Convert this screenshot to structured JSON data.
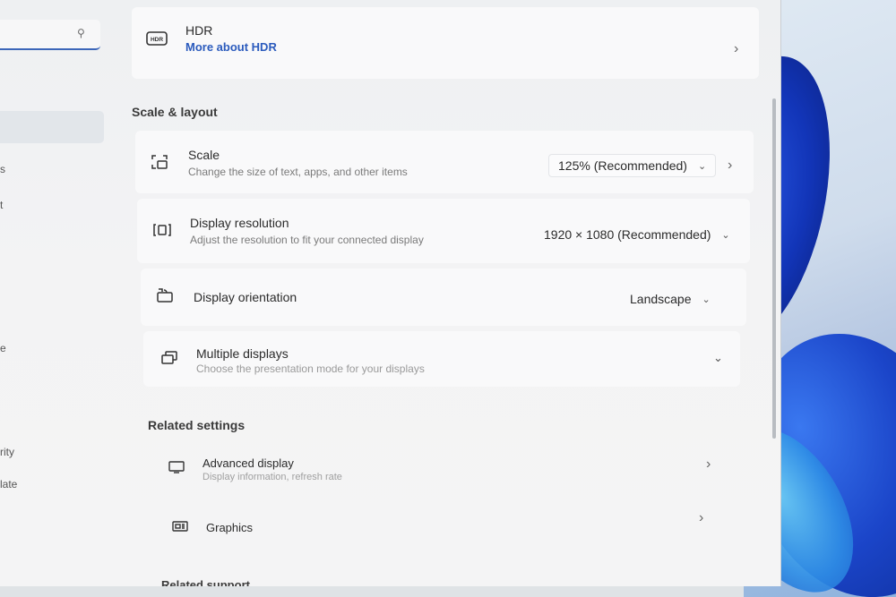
{
  "sidebar": {
    "search_icon": "search-icon",
    "fragments": [
      "s",
      "t",
      "e",
      "rity",
      "late"
    ]
  },
  "hdr": {
    "title": "HDR",
    "link": "More about HDR",
    "icon": "hdr-icon"
  },
  "scale_layout": {
    "heading": "Scale & layout",
    "scale": {
      "title": "Scale",
      "subtitle": "Change the size of text, apps, and other items",
      "value": "125% (Recommended)"
    },
    "resolution": {
      "title": "Display resolution",
      "subtitle": "Adjust the resolution to fit your connected display",
      "value": "1920 × 1080 (Recommended)"
    },
    "orientation": {
      "title": "Display orientation",
      "value": "Landscape"
    },
    "multiple": {
      "title": "Multiple displays",
      "subtitle": "Choose the presentation mode for your displays"
    }
  },
  "related_settings": {
    "heading": "Related settings",
    "advanced": {
      "title": "Advanced display",
      "subtitle": "Display information, refresh rate"
    },
    "graphics": {
      "title": "Graphics"
    }
  },
  "related_support": {
    "heading": "Related support"
  }
}
